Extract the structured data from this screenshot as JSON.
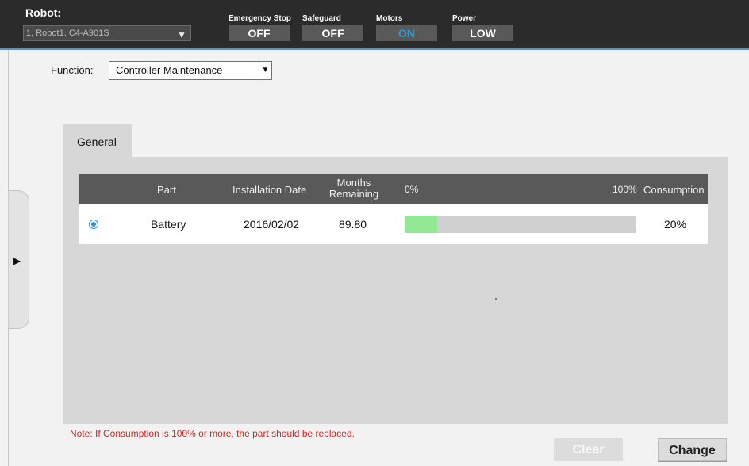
{
  "header": {
    "robot_label": "Robot:",
    "robot_value": "1, Robot1, C4-A901S",
    "statuses": [
      {
        "label": "Emergency Stop",
        "value": "OFF"
      },
      {
        "label": "Safeguard",
        "value": "OFF"
      },
      {
        "label": "Motors",
        "value": "ON"
      },
      {
        "label": "Power",
        "value": "LOW"
      }
    ]
  },
  "function": {
    "label": "Function:",
    "value": "Controller Maintenance"
  },
  "tabs": [
    {
      "label": "General"
    }
  ],
  "table": {
    "columns": [
      "Part",
      "Installation Date",
      "Months Remaining",
      "0%",
      "100%",
      "Consumption"
    ],
    "rows": [
      {
        "part": "Battery",
        "installation_date": "2016/02/02",
        "months_remaining": "89.80",
        "consumption": "20%",
        "consumption_fraction": 0.14,
        "selected": true
      }
    ]
  },
  "note": "Note: If Consumption is 100% or more, the part should be replaced.",
  "buttons": {
    "clear": "Clear",
    "change": "Change"
  },
  "colors": {
    "accent": "#2f9bd6",
    "bar_fill": "#93e893",
    "note": "#e02020"
  }
}
